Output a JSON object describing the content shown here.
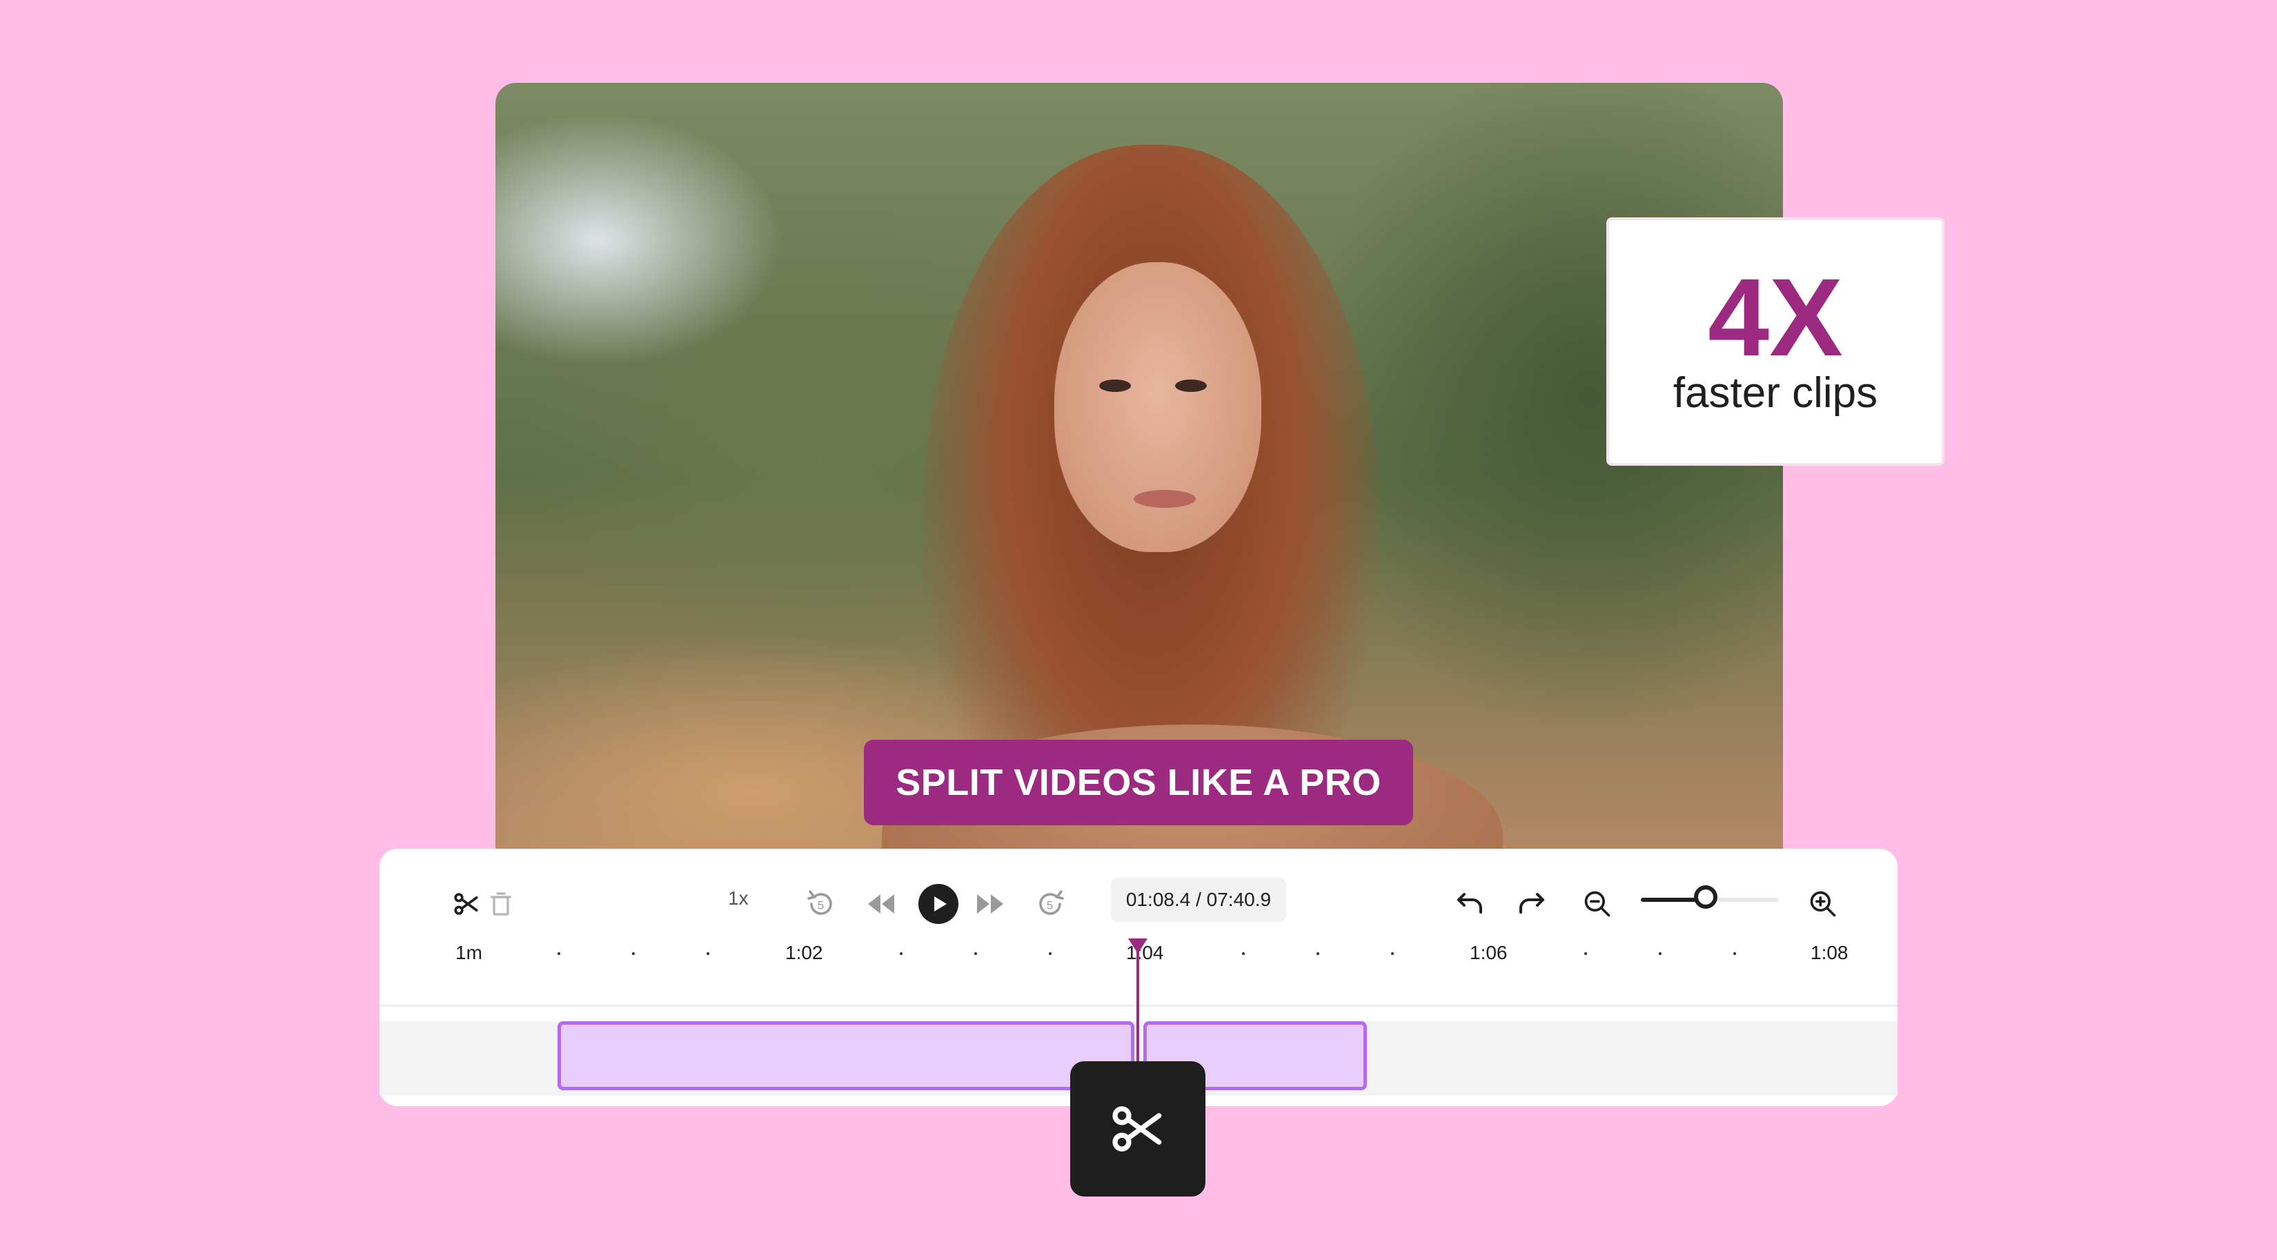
{
  "video": {
    "caption": "SPLIT VIDEOS LIKE A PRO"
  },
  "stat_card": {
    "value": "4X",
    "label": "faster clips"
  },
  "toolbar": {
    "split_icon": "scissors-icon",
    "delete_icon": "trash-icon",
    "playback_rate": "1x",
    "rewind_5_icon": "rewind-5-icon",
    "prev_icon": "rewind-icon",
    "play_icon": "play-icon",
    "next_icon": "fast-forward-icon",
    "forward_5_icon": "forward-5-icon",
    "time": "01:08.4 / 07:40.9",
    "undo_icon": "undo-icon",
    "redo_icon": "redo-icon",
    "zoom_out_icon": "zoom-out-icon",
    "zoom_level": 0.47,
    "zoom_in_icon": "zoom-in-icon"
  },
  "ruler": {
    "labels": [
      "1m",
      "1:02",
      "1:04",
      "1:06",
      "1:08"
    ]
  },
  "split_button_icon": "scissors-icon",
  "colors": {
    "background": "#ffbde8",
    "accent": "#9c2a80",
    "clip_fill": "#e8cdfb",
    "clip_border": "#b46bf1"
  }
}
